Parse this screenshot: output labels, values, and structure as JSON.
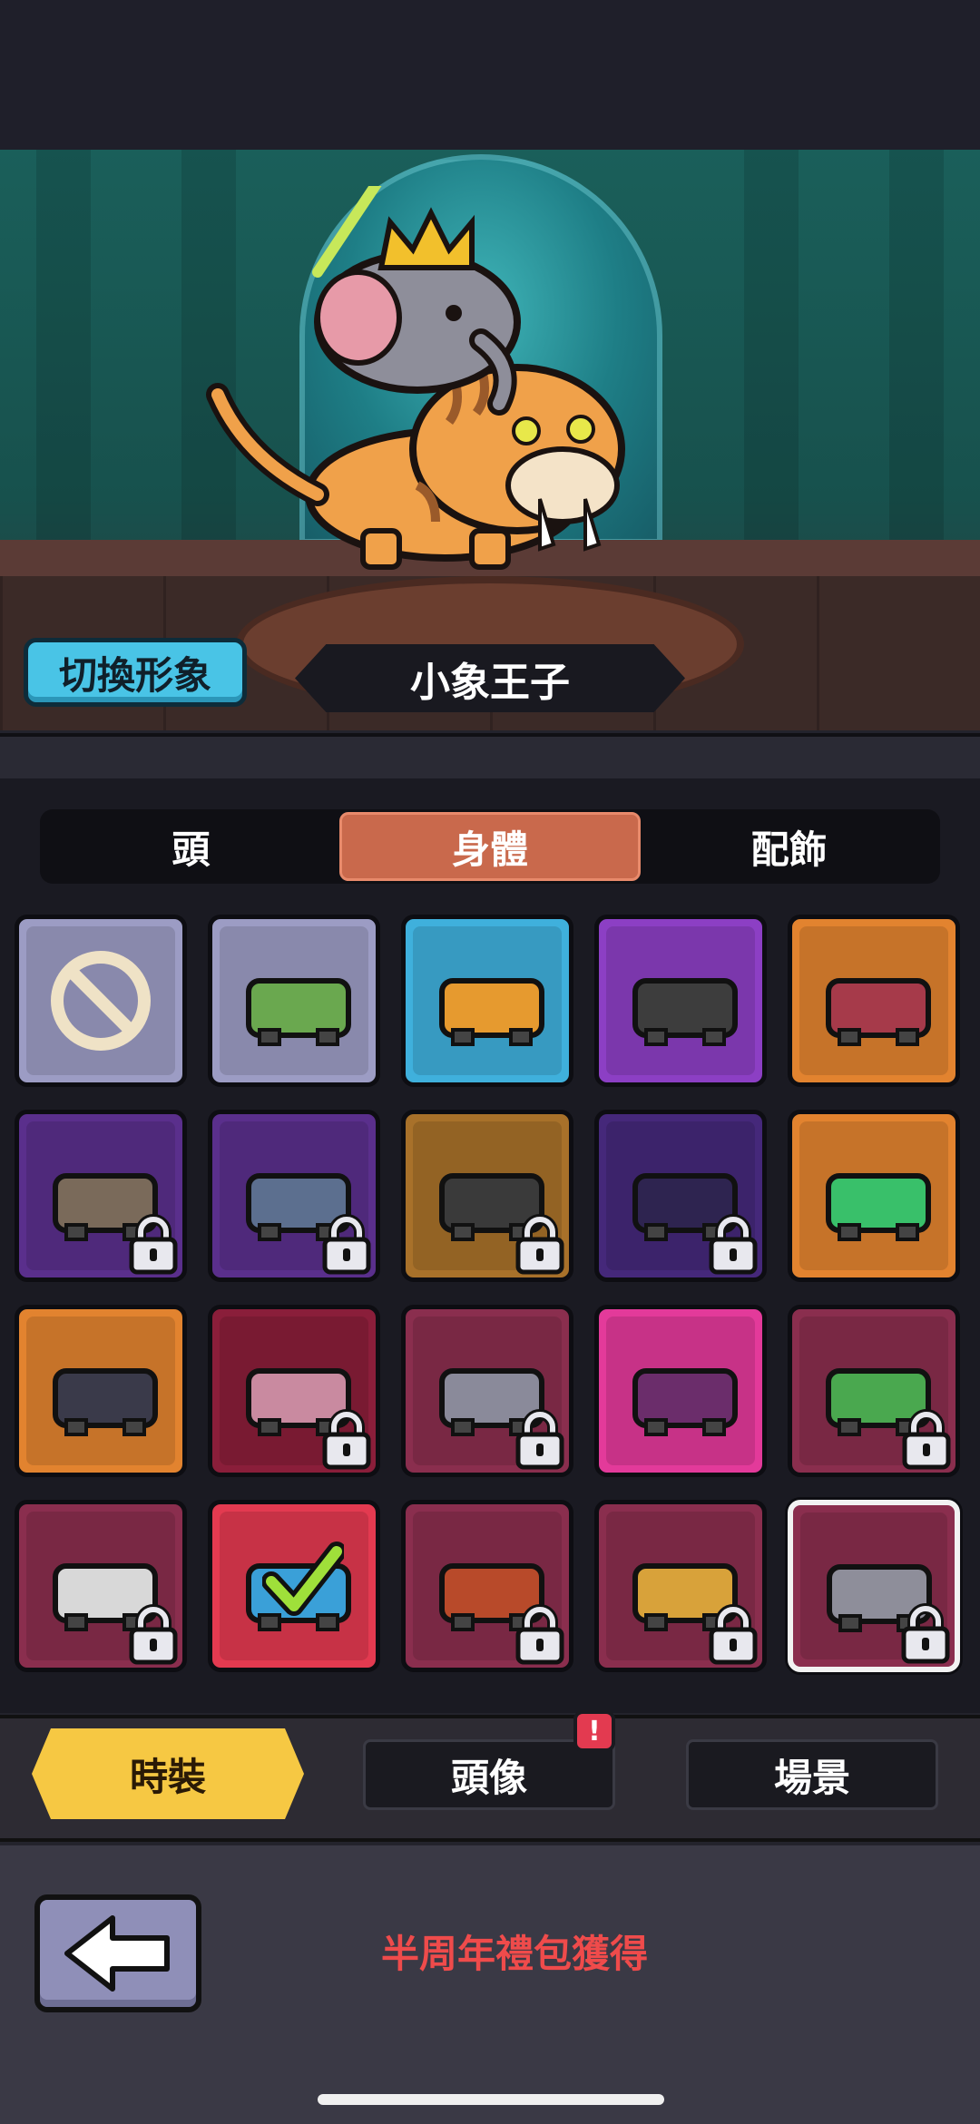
{
  "character": {
    "name": "小象王子",
    "switch_label": "切換形象"
  },
  "tabs": [
    {
      "label": "頭",
      "active": false
    },
    {
      "label": "身體",
      "active": true
    },
    {
      "label": "配飾",
      "active": false
    }
  ],
  "items": [
    {
      "name": "none",
      "bg": "#9c9cc4",
      "locked": false
    },
    {
      "name": "green-scarf",
      "bg": "#9c9cc4",
      "locked": false
    },
    {
      "name": "orange-cape",
      "bg": "#3fb0dc",
      "locked": false
    },
    {
      "name": "dark-cape",
      "bg": "#8c3fc4",
      "locked": false
    },
    {
      "name": "red-cape",
      "bg": "#e2832f",
      "locked": false
    },
    {
      "name": "fish-vest",
      "bg": "#5a2f8c",
      "locked": true
    },
    {
      "name": "grey-cloak",
      "bg": "#5a2f8c",
      "locked": true
    },
    {
      "name": "black-cape",
      "bg": "#a8712a",
      "locked": true
    },
    {
      "name": "purple-cloak",
      "bg": "#45287a",
      "locked": true
    },
    {
      "name": "frog-suit",
      "bg": "#e2832f",
      "locked": false
    },
    {
      "name": "ninja-suit",
      "bg": "#e2832f",
      "locked": false
    },
    {
      "name": "rabbit-suit",
      "bg": "#8a1e3a",
      "locked": true
    },
    {
      "name": "knight-suit",
      "bg": "#8a2e4e",
      "locked": true
    },
    {
      "name": "turkey-suit",
      "bg": "#e33a9a",
      "locked": false
    },
    {
      "name": "gift-suit",
      "bg": "#8a2e4e",
      "locked": true
    },
    {
      "name": "lion-dance-suit",
      "bg": "#8a2e4e",
      "locked": true
    },
    {
      "name": "fish-suit",
      "bg": "#e33a50",
      "locked": false,
      "equipped": true
    },
    {
      "name": "dragon-suit",
      "bg": "#8a2e4e",
      "locked": true
    },
    {
      "name": "golden-armor",
      "bg": "#8a2e4e",
      "locked": true
    },
    {
      "name": "elephant-suit",
      "bg": "#8a2e4e",
      "locked": true,
      "selected": true
    }
  ],
  "bottom_nav": {
    "fashion": "時裝",
    "avatar": "頭像",
    "scene": "場景",
    "avatar_badge": "!"
  },
  "obtain_text": "半周年禮包獲得"
}
